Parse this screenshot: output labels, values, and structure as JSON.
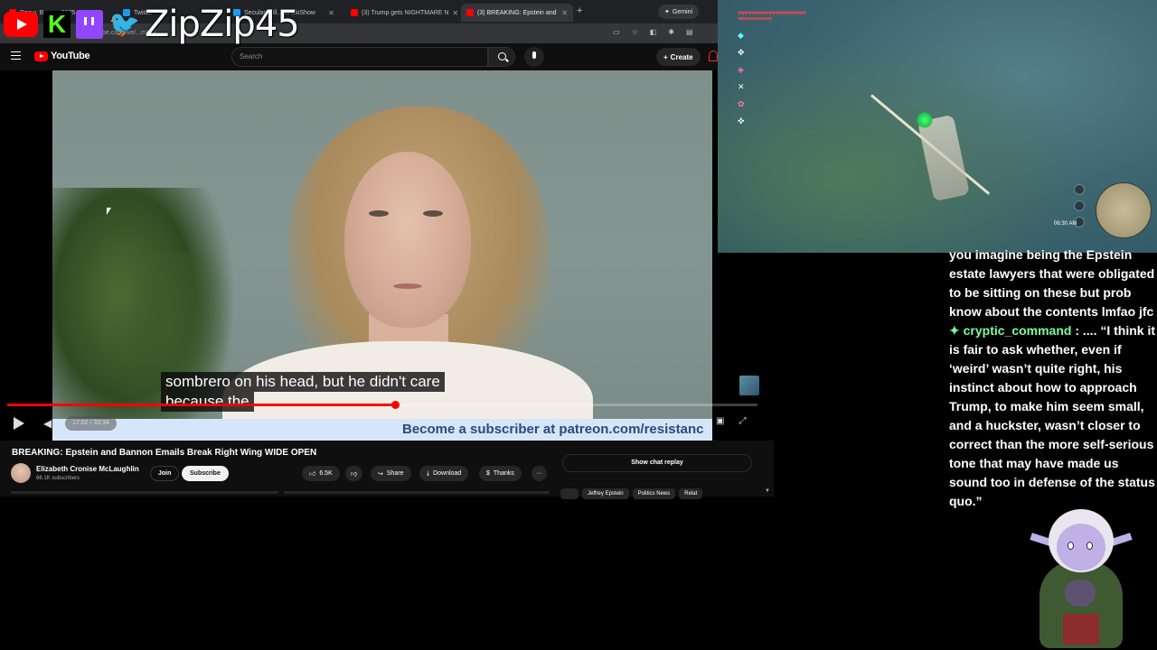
{
  "overlay": {
    "streamer_name": "ZipZip45",
    "kick_glyph": "K",
    "twitter_glyph": "🐦"
  },
  "browser": {
    "tabs": [
      {
        "label": "Doe v. Bonn... 2075"
      },
      {
        "label": "Twitter"
      },
      {
        "label": "SecularGrill...alinskiShow"
      },
      {
        "label": "(3) Trump gets NIGHTMARE N"
      },
      {
        "label": "(3) BREAKING: Epstein and"
      }
    ],
    "new_tab_glyph": "+",
    "gemini_label": "Gemini",
    "url": "...youtube.com/live/...mDjX"
  },
  "youtube": {
    "logo_text": "YouTube",
    "search_placeholder": "Search",
    "create_label": "Create",
    "subtitle_line1": "sombrero on his head, but he didn't care",
    "subtitle_line2": "because the",
    "banner_text": "Become a subscriber at patreon.com/resistanc",
    "time_display": "17:02 / 33:34",
    "progress_fraction": 0.517,
    "video_title": "BREAKING: Epstein and Bannon Emails Break Right Wing WIDE OPEN",
    "channel_name": "Elizabeth Cronise McLaughlin",
    "subscriber_count": "66.1K subscribers",
    "join_label": "Join",
    "subscribe_label": "Subscribe",
    "like_count": "6.5K",
    "share_label": "Share",
    "download_label": "Download",
    "thanks_label": "Thanks",
    "more_glyph": "···",
    "show_chat_replay": "Show chat replay",
    "chips": [
      "Jeffrey Epstein",
      "Politics News",
      "Relat"
    ]
  },
  "chat": {
    "message_continuation": "you imagine being the Epstein estate lawyers that were obligated to be sitting on these but prob know about the contents lmfao jfc",
    "badge_glyph": "✦",
    "username": "cryptic_command",
    "message": " : .... “I think it is fair to ask whether, even if ‘weird’ wasn’t quite right, his instinct about how to approach Trump, to make him seem small, and a huckster, wasn’t closer to correct than the more self-serious tone that may have made us sound too in defense of the status quo.”"
  },
  "game": {
    "hearts": "♥♥♥♥♥♥♥♥♥♥♥♥♥♥♥♥♥♥♥♥",
    "hearts_row2": "♥♥♥♥♥♥♥♥♥♥♥♥",
    "clock": "06:30 AM"
  }
}
